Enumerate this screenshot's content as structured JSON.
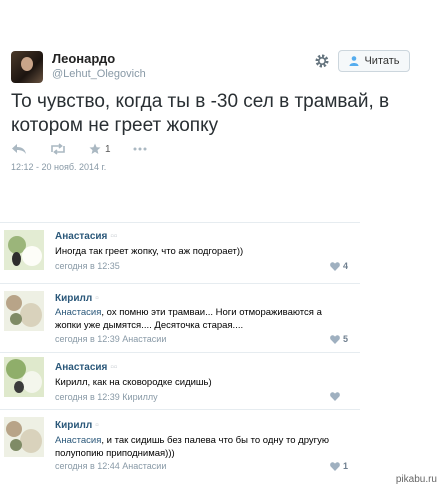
{
  "tweet": {
    "author_name": "Леонардо",
    "author_handle": "@Lehut_Olegovich",
    "follow_label": "Читать",
    "text": "То чувство, когда ты в -30 сел в трамвай, в котором не греет жопку",
    "favorite_count": "1",
    "timestamp": "12:12 - 20 нояб. 2014 г."
  },
  "comments": [
    {
      "name": "Анастасия",
      "text": "Иногда так греет жопку, что аж подгорает))",
      "meta": "сегодня в 12:35",
      "likes": "4"
    },
    {
      "name": "Кирилл",
      "mention": "Анастасия",
      "text": ", ох помню эти трамваи... Ноги отмораживаются а жопки уже дымятся.... Десяточка старая....",
      "meta": "сегодня в 12:39 Анастасии",
      "likes": "5"
    },
    {
      "name": "Анастасия",
      "text": "Кирилл, как на сковородке сидишь)",
      "meta": "сегодня в 12:39 Кириллу",
      "likes": ""
    },
    {
      "name": "Кирилл",
      "mention": "Анастасия",
      "text": ", и так сидишь без палева что бы то одну то другую полупопию приподнимая)))",
      "meta": "сегодня в 12:44 Анастасии",
      "likes": "1"
    }
  ],
  "watermark": "pikabu.ru",
  "colors": {
    "accent": "#2b587a",
    "muted": "#8899a6"
  }
}
